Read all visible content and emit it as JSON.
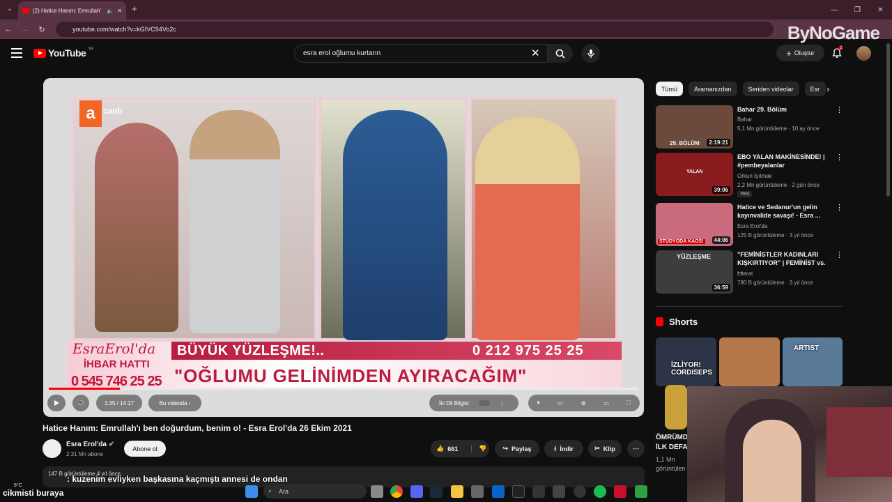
{
  "browser": {
    "tab_title": "(2) Hatice Hanım: Emrullah'",
    "url": "youtube.com/watch?v=kGIVC94Vo2c",
    "overlay_logo": "ByNoGame"
  },
  "header": {
    "logo_text": "YouTube",
    "region": "TR",
    "search_value": "esra erol oğlumu kurtarın",
    "create_label": "Oluştur",
    "notif_count": "2"
  },
  "video": {
    "channel_logo": "a",
    "channel_logo_sub": "canlı",
    "banner_brand": "EsraErol'da",
    "hotline_label": "İHBAR HATTI",
    "hotline_number": "0 545 746 25 25",
    "banner_title": "BÜYÜK YÜZLEŞME!..",
    "banner_phone": "0 212 975 25 25",
    "banner_quote": "\"OĞLUMU GELİNİMDEN AYIRACAĞIM\"",
    "progress_fraction": 0.12,
    "time": "1:35 / 14:17",
    "chapter_label": "Bu videoda",
    "dub_label": "İki Dil Bilgisi",
    "title": "Hatice Hanım: Emrullah'ı ben doğurdum, benim o! - Esra Erol'da 26 Ekim 2021",
    "channel_name": "Esra Erol'da",
    "subscribers": "2,31 Mn abone",
    "subscribe_label": "Abone ol",
    "likes": "661",
    "share_label": "Paylaş",
    "download_label": "İndir",
    "clip_label": "Klip",
    "views_meta": "147 B görüntüleme  4 yıl önce"
  },
  "chat": {
    "line1_user": "",
    "line1_text": ": kuzenim evliyken başkasına kaçmıştı annesi de ondan",
    "line2_text": "cikmisti buraya"
  },
  "chips": [
    "Tümü",
    "Aramanızdan",
    "Seriden videolar",
    "Esr"
  ],
  "recommendations": [
    {
      "title": "Bahar 29. Bölüm",
      "channel": "Bahar",
      "meta": "5,1 Mn görüntüleme · 10 ay önce",
      "duration": "2:19:21",
      "thumb_text": "29. BÖLÜM",
      "thumb_color": "#6b4a3c"
    },
    {
      "title": "EBO YALAN MAKİNESİNDE! | #pembeyalanlar",
      "channel": "Orkun Işıtmak",
      "meta": "2,2 Mn görüntüleme · 2 gün önce",
      "duration": "39:06",
      "thumb_text": "YALAN",
      "thumb_color": "#8a1b1f",
      "tag": "Yeni"
    },
    {
      "title": "Hatice ve Sedanur'un gelin kayınvalide savaşı! - Esra ...",
      "channel": "Esra Erol'da",
      "meta": "125 B görüntüleme · 3 yıl önce",
      "duration": "44:06",
      "thumb_text": "STÜDYODA KAOS!",
      "thumb_color": "#c96b7c"
    },
    {
      "title": "\"FEMİNİSTLER KADINLARI KIŞKIRTIYOR\" | FEMİNİST vs. ...",
      "channel": "Literat",
      "meta": "780 B görüntüleme · 3 yıl önce",
      "duration": "36:59",
      "thumb_text": "YÜZLEŞME",
      "thumb_color": "#3d3d3d"
    }
  ],
  "shorts": {
    "heading": "Shorts",
    "items": [
      {
        "text": "İZLİYOR! CORDISEPS",
        "color": "#2e3448"
      },
      {
        "text": "",
        "color": "#b5784a"
      },
      {
        "text": "ARTIST",
        "color": "#5a7a9a"
      }
    ],
    "caption_title_1": "ÖMRÜMD",
    "caption_title_2": "İLK DEFA",
    "caption_meta_1": "1,1 Mn",
    "caption_meta_2": "görüntülen"
  },
  "taskbar": {
    "search_placeholder": "Ara",
    "weather": "8°C"
  }
}
